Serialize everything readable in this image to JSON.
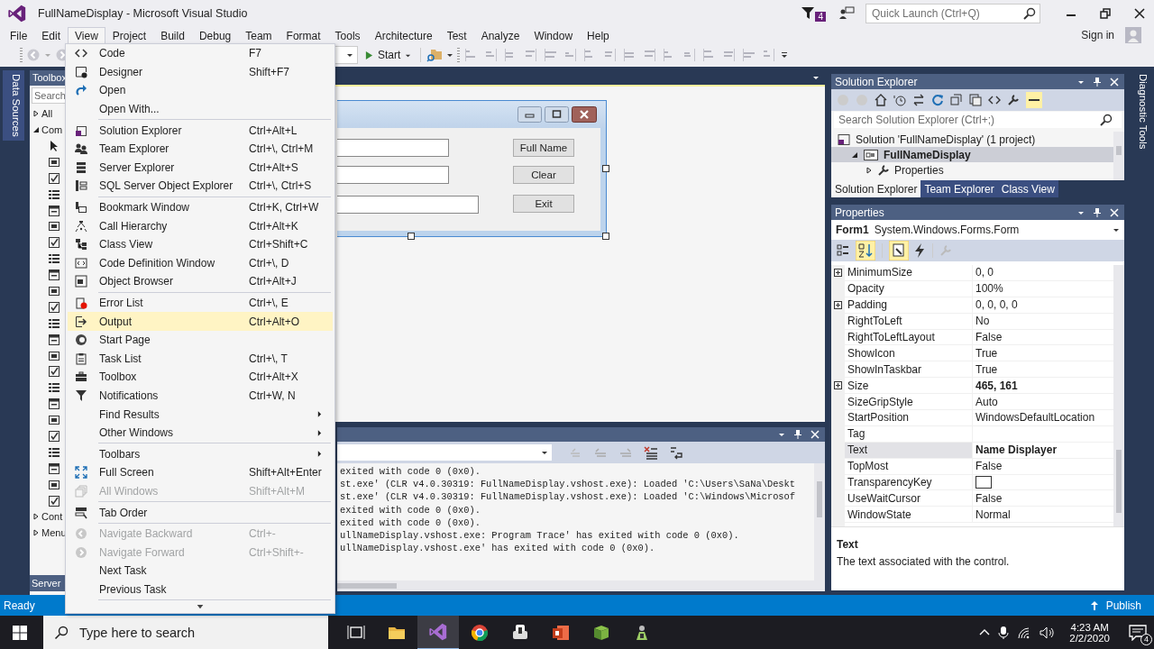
{
  "window": {
    "title": "FullNameDisplay - Microsoft Visual Studio",
    "notification_count": "4",
    "quick_launch": {
      "placeholder": "Quick Launch (Ctrl+Q)"
    },
    "sign_in": "Sign in"
  },
  "menu_bar": [
    {
      "label": "File",
      "selected": false
    },
    {
      "label": "Edit",
      "selected": false
    },
    {
      "label": "View",
      "selected": true
    },
    {
      "label": "Project",
      "selected": false
    },
    {
      "label": "Build",
      "selected": false
    },
    {
      "label": "Debug",
      "selected": false
    },
    {
      "label": "Team",
      "selected": false
    },
    {
      "label": "Format",
      "selected": false
    },
    {
      "label": "Tools",
      "selected": false
    },
    {
      "label": "Architecture",
      "selected": false
    },
    {
      "label": "Test",
      "selected": false
    },
    {
      "label": "Analyze",
      "selected": false
    },
    {
      "label": "Window",
      "selected": false
    },
    {
      "label": "Help",
      "selected": false
    }
  ],
  "toolbar": {
    "start_label": "Start"
  },
  "side_tabs": {
    "left": "Data Sources",
    "right": "Diagnostic Tools"
  },
  "toolbox": {
    "title": "Toolbox",
    "search": {
      "placeholder": "Search"
    },
    "groups": [
      {
        "label": "All",
        "expanded": false
      },
      {
        "label": "Com",
        "expanded": true
      },
      {
        "label": "Cont",
        "expanded": false
      },
      {
        "label": "Menu",
        "expanded": false
      }
    ],
    "bottom_tab": "Server"
  },
  "view_menu": [
    {
      "kind": "item",
      "label": "Code",
      "shortcut": "F7",
      "disabled": false,
      "selected": false,
      "submenu": false
    },
    {
      "kind": "item",
      "label": "Designer",
      "shortcut": "Shift+F7",
      "disabled": false,
      "selected": false,
      "submenu": false
    },
    {
      "kind": "item",
      "label": "Open",
      "disabled": false,
      "selected": false,
      "submenu": false
    },
    {
      "kind": "item",
      "label": "Open With...",
      "disabled": false,
      "selected": false,
      "submenu": false
    },
    {
      "kind": "separator"
    },
    {
      "kind": "item",
      "label": "Solution Explorer",
      "shortcut": "Ctrl+Alt+L",
      "disabled": false,
      "selected": false,
      "submenu": false
    },
    {
      "kind": "item",
      "label": "Team Explorer",
      "shortcut": "Ctrl+\\, Ctrl+M",
      "disabled": false,
      "selected": false,
      "submenu": false
    },
    {
      "kind": "item",
      "label": "Server Explorer",
      "shortcut": "Ctrl+Alt+S",
      "disabled": false,
      "selected": false,
      "submenu": false
    },
    {
      "kind": "item",
      "label": "SQL Server Object Explorer",
      "shortcut": "Ctrl+\\, Ctrl+S",
      "disabled": false,
      "selected": false,
      "submenu": false
    },
    {
      "kind": "separator"
    },
    {
      "kind": "item",
      "label": "Bookmark Window",
      "shortcut": "Ctrl+K, Ctrl+W",
      "disabled": false,
      "selected": false,
      "submenu": false
    },
    {
      "kind": "item",
      "label": "Call Hierarchy",
      "shortcut": "Ctrl+Alt+K",
      "disabled": false,
      "selected": false,
      "submenu": false
    },
    {
      "kind": "item",
      "label": "Class View",
      "shortcut": "Ctrl+Shift+C",
      "disabled": false,
      "selected": false,
      "submenu": false
    },
    {
      "kind": "item",
      "label": "Code Definition Window",
      "shortcut": "Ctrl+\\, D",
      "disabled": false,
      "selected": false,
      "submenu": false
    },
    {
      "kind": "item",
      "label": "Object Browser",
      "shortcut": "Ctrl+Alt+J",
      "disabled": false,
      "selected": false,
      "submenu": false
    },
    {
      "kind": "separator"
    },
    {
      "kind": "item",
      "label": "Error List",
      "shortcut": "Ctrl+\\, E",
      "disabled": false,
      "selected": false,
      "submenu": false
    },
    {
      "kind": "item",
      "label": "Output",
      "shortcut": "Ctrl+Alt+O",
      "disabled": false,
      "selected": true,
      "submenu": false
    },
    {
      "kind": "item",
      "label": "Start Page",
      "disabled": false,
      "selected": false,
      "submenu": false
    },
    {
      "kind": "item",
      "label": "Task List",
      "shortcut": "Ctrl+\\, T",
      "disabled": false,
      "selected": false,
      "submenu": false
    },
    {
      "kind": "item",
      "label": "Toolbox",
      "shortcut": "Ctrl+Alt+X",
      "disabled": false,
      "selected": false,
      "submenu": false
    },
    {
      "kind": "item",
      "label": "Notifications",
      "shortcut": "Ctrl+W, N",
      "disabled": false,
      "selected": false,
      "submenu": false
    },
    {
      "kind": "item",
      "label": "Find Results",
      "disabled": false,
      "selected": false,
      "submenu": true
    },
    {
      "kind": "item",
      "label": "Other Windows",
      "disabled": false,
      "selected": false,
      "submenu": true
    },
    {
      "kind": "separator"
    },
    {
      "kind": "item",
      "label": "Toolbars",
      "disabled": false,
      "selected": false,
      "submenu": true
    },
    {
      "kind": "item",
      "label": "Full Screen",
      "shortcut": "Shift+Alt+Enter",
      "disabled": false,
      "selected": false,
      "submenu": false
    },
    {
      "kind": "item",
      "label": "All Windows",
      "shortcut": "Shift+Alt+M",
      "disabled": true,
      "selected": false,
      "submenu": false
    },
    {
      "kind": "separator"
    },
    {
      "kind": "item",
      "label": "Tab Order",
      "disabled": false,
      "selected": false,
      "submenu": false
    },
    {
      "kind": "separator"
    },
    {
      "kind": "item",
      "label": "Navigate Backward",
      "shortcut": "Ctrl+-",
      "disabled": true,
      "selected": false,
      "submenu": false
    },
    {
      "kind": "item",
      "label": "Navigate Forward",
      "shortcut": "Ctrl+Shift+-",
      "disabled": true,
      "selected": false,
      "submenu": false
    },
    {
      "kind": "item",
      "label": "Next Task",
      "disabled": false,
      "selected": false,
      "submenu": false
    },
    {
      "kind": "item",
      "label": "Previous Task",
      "disabled": false,
      "selected": false,
      "submenu": false
    },
    {
      "kind": "separator"
    }
  ],
  "form_designer": {
    "buttons": [
      "Full Name",
      "Clear",
      "Exit"
    ]
  },
  "output": {
    "lines": [
      "exited with code 0 (0x0).",
      "st.exe' (CLR v4.0.30319: FullNameDisplay.vshost.exe): Loaded 'C:\\Users\\SaNa\\Deskt",
      "st.exe' (CLR v4.0.30319: FullNameDisplay.vshost.exe): Loaded 'C:\\Windows\\Microsof",
      "exited with code 0 (0x0).",
      "exited with code 0 (0x0).",
      "ullNameDisplay.vshost.exe: Program Trace' has exited with code 0 (0x0).",
      "ullNameDisplay.vshost.exe' has exited with code 0 (0x0)."
    ]
  },
  "solution_explorer": {
    "title": "Solution Explorer",
    "search": {
      "placeholder": "Search Solution Explorer (Ctrl+;)"
    },
    "tree": [
      {
        "label": "Solution 'FullNameDisplay' (1 project)",
        "kind": "solution",
        "selected": false,
        "children": [
          {
            "label": "FullNameDisplay",
            "kind": "project",
            "selected": true,
            "expanded": true,
            "children": [
              {
                "label": "Properties",
                "kind": "properties",
                "selected": false,
                "expanded": false
              }
            ]
          }
        ]
      }
    ],
    "tabs": [
      {
        "label": "Solution Explorer",
        "selected": true
      },
      {
        "label": "Team Explorer",
        "selected": false
      },
      {
        "label": "Class View",
        "selected": false
      }
    ]
  },
  "properties": {
    "title": "Properties",
    "object": {
      "name": "Form1",
      "type": "System.Windows.Forms.Form"
    },
    "rows": [
      {
        "name": "MinimumSize",
        "value": "0, 0",
        "expandable": true,
        "modified": false,
        "selected": false
      },
      {
        "name": "Opacity",
        "value": "100%",
        "expandable": false,
        "modified": false,
        "selected": false
      },
      {
        "name": "Padding",
        "value": "0, 0, 0, 0",
        "expandable": true,
        "modified": false,
        "selected": false
      },
      {
        "name": "RightToLeft",
        "value": "No",
        "expandable": false,
        "modified": false,
        "selected": false
      },
      {
        "name": "RightToLeftLayout",
        "value": "False",
        "expandable": false,
        "modified": false,
        "selected": false
      },
      {
        "name": "ShowIcon",
        "value": "True",
        "expandable": false,
        "modified": false,
        "selected": false
      },
      {
        "name": "ShowInTaskbar",
        "value": "True",
        "expandable": false,
        "modified": false,
        "selected": false
      },
      {
        "name": "Size",
        "value": "465, 161",
        "expandable": true,
        "modified": true,
        "selected": false
      },
      {
        "name": "SizeGripStyle",
        "value": "Auto",
        "expandable": false,
        "modified": false,
        "selected": false
      },
      {
        "name": "StartPosition",
        "value": "WindowsDefaultLocation",
        "expandable": false,
        "modified": false,
        "selected": false
      },
      {
        "name": "Tag",
        "expandable": false,
        "selected": false
      },
      {
        "name": "Text",
        "value": "Name Displayer",
        "expandable": false,
        "modified": true,
        "selected": true
      },
      {
        "name": "TopMost",
        "value": "False",
        "expandable": false,
        "modified": false,
        "selected": false
      },
      {
        "name": "TransparencyKey",
        "kind": "color",
        "color": "#ffffff",
        "expandable": false,
        "modified": false,
        "selected": false
      },
      {
        "name": "UseWaitCursor",
        "value": "False",
        "expandable": false,
        "modified": false,
        "selected": false
      },
      {
        "name": "WindowState",
        "value": "Normal",
        "expandable": false,
        "modified": false,
        "selected": false
      }
    ],
    "description": {
      "title": "Text",
      "text": "The text associated with the control."
    }
  },
  "status_bar": {
    "text": "Ready",
    "publish": "Publish"
  },
  "taskbar": {
    "search": {
      "placeholder": "Type here to search"
    },
    "time": "4:23 AM",
    "date": "2/2/2020",
    "notification_count": "4"
  }
}
